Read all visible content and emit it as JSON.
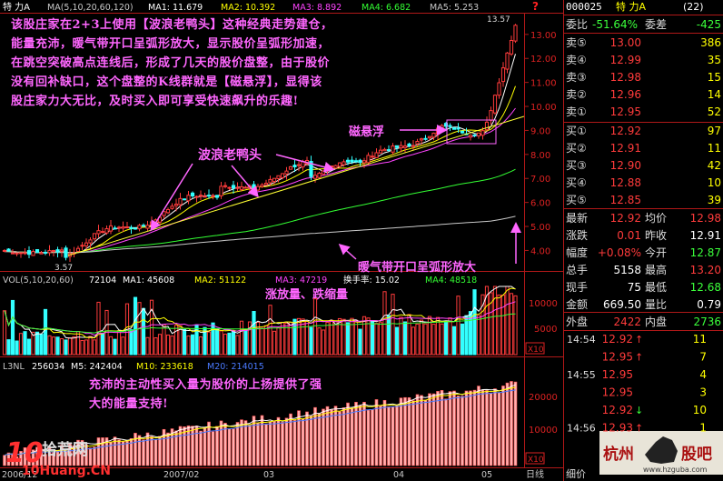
{
  "header": {
    "stock": "特 力A",
    "ma_label": "MA(5,10,20,60,120)",
    "ma1": "MA1: 11.679",
    "ma2": "MA2: 10.392",
    "ma3": "MA3: 8.892",
    "ma4": "MA4: 6.682",
    "ma5": "MA5: 5.253"
  },
  "price_axis": [
    "13.00",
    "12.00",
    "11.00",
    "10.00",
    "9.00",
    "8.00",
    "7.00",
    "6.00",
    "5.00",
    "4.00"
  ],
  "price_high_label": "13.57",
  "price_low_label": "3.57",
  "question_mark": "?",
  "annotations": {
    "main_text": "该股庄家在2+3上使用【波浪老鸭头】这种经典走势建仓，能量充沛，暖气带开口呈弧形放大，显示股价呈弧形加速，在跳空突破高点连线后，形成了几天的股价盘整，由于股价没有回补缺口，这个盘整的K线群就是【磁悬浮】，显得该股庄家力大无比，及时买入即可享受快速飙升的乐趣!",
    "wave_duck": "波浪老鸭头",
    "maglev": "磁悬浮",
    "warm_band": "暖气带开口呈弧形放大",
    "vol_text": "涨放量、跌缩量",
    "l3nl_text": "充沛的主动性买入量为股价的上扬提供了强大的能量支持!"
  },
  "vol_header": {
    "label": "VOL(5,10,20,60)",
    "value": "72104",
    "ma1": "MA1: 45608",
    "ma2": "MA2: 51122",
    "ma3": "MA3: 47219",
    "turnover": "换手率: 15.02",
    "ma4": "MA4: 48518"
  },
  "vol_axis": [
    "10000",
    "5000"
  ],
  "x10_label": "X10",
  "l3nl_header": {
    "label": "L3NL",
    "value": "256034",
    "m5": "M5: 242404",
    "m10": "M10: 233618",
    "m20": "M20: 214015"
  },
  "l3nl_axis": [
    "20000",
    "10000"
  ],
  "date_axis": [
    "2006/12",
    "2007/02",
    "03",
    "04",
    "05"
  ],
  "date_label": "日线",
  "watermark_left": {
    "num": "10",
    "name": "拾荒网",
    "url": "10Huang.CN"
  },
  "watermark_right": {
    "name1": "杭州",
    "name2": "股吧",
    "url": "www.hzguba.com"
  },
  "quote": {
    "code": "000025",
    "name": "特 力A",
    "count": "(22)",
    "webi_label": "委比",
    "webi_value": "-51.64%",
    "weicha_label": "委差",
    "weicha_value": "-425",
    "sells": [
      {
        "label": "卖⑤",
        "price": "13.00",
        "vol": "386"
      },
      {
        "label": "卖④",
        "price": "12.99",
        "vol": "35"
      },
      {
        "label": "卖③",
        "price": "12.98",
        "vol": "15"
      },
      {
        "label": "卖②",
        "price": "12.96",
        "vol": "14"
      },
      {
        "label": "卖①",
        "price": "12.95",
        "vol": "52"
      }
    ],
    "buys": [
      {
        "label": "买①",
        "price": "12.92",
        "vol": "97"
      },
      {
        "label": "买②",
        "price": "12.91",
        "vol": "11"
      },
      {
        "label": "买③",
        "price": "12.90",
        "vol": "42"
      },
      {
        "label": "买④",
        "price": "12.88",
        "vol": "10"
      },
      {
        "label": "买⑤",
        "price": "12.85",
        "vol": "39"
      }
    ],
    "stats": [
      {
        "l1": "最新",
        "v1": "12.92",
        "l2": "均价",
        "v2": "12.98",
        "c1": "#ff3b3b",
        "c2": "#ff3b3b"
      },
      {
        "l1": "涨跌",
        "v1": "0.01",
        "l2": "昨收",
        "v2": "12.91",
        "c1": "#ff3b3b",
        "c2": "#ffffff"
      },
      {
        "l1": "幅度",
        "v1": "+0.08%",
        "l2": "今开",
        "v2": "12.87",
        "c1": "#ff3b3b",
        "c2": "#3bff3b"
      },
      {
        "l1": "总手",
        "v1": "5158",
        "l2": "最高",
        "v2": "13.20",
        "c1": "#ffffff",
        "c2": "#ff3b3b"
      },
      {
        "l1": "现手",
        "v1": "75",
        "l2": "最低",
        "v2": "12.68",
        "c1": "#ffffff",
        "c2": "#3bff3b"
      },
      {
        "l1": "金额",
        "v1": "669.50",
        "l2": "量比",
        "v2": "0.79",
        "c1": "#ffffff",
        "c2": "#ffffff"
      }
    ],
    "waipan_label": "外盘",
    "waipan_value": "2422",
    "neipan_label": "内盘",
    "neipan_value": "2736",
    "ticks": [
      {
        "time": "14:54",
        "price": "12.92",
        "arrow": "↑",
        "vol": "11",
        "pc": "#ff3b3b",
        "ac": "#ff3b3b"
      },
      {
        "time": "",
        "price": "12.95",
        "arrow": "↑",
        "vol": "7",
        "pc": "#ff3b3b",
        "ac": "#ff3b3b"
      },
      {
        "time": "14:55",
        "price": "12.95",
        "arrow": "",
        "vol": "4",
        "pc": "#ff3b3b",
        "ac": "#ff3b3b"
      },
      {
        "time": "",
        "price": "12.95",
        "arrow": "",
        "vol": "3",
        "pc": "#ff3b3b",
        "ac": "#ff3b3b"
      },
      {
        "time": "",
        "price": "12.92",
        "arrow": "↓",
        "vol": "10",
        "pc": "#ff3b3b",
        "ac": "#3bff3b"
      },
      {
        "time": "14:56",
        "price": "12.93",
        "arrow": "↑",
        "vol": "1",
        "pc": "#ff3b3b",
        "ac": "#ff3b3b"
      }
    ],
    "detail_label": "细价"
  }
}
